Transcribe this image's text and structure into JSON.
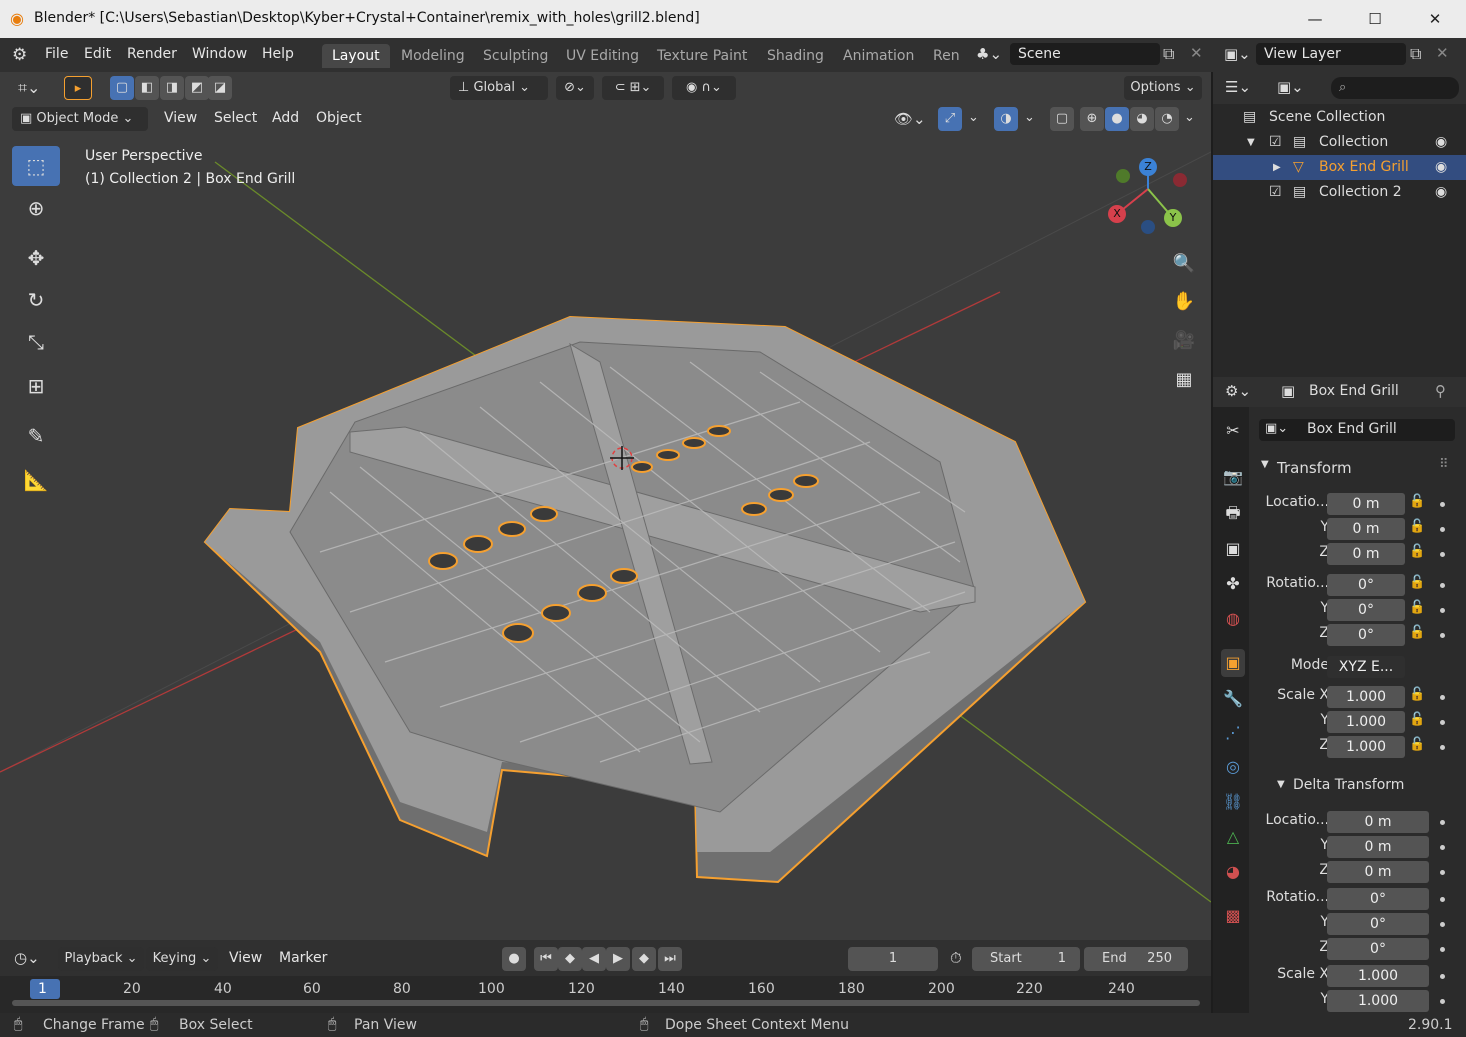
{
  "window": {
    "title": "Blender* [C:\\Users\\Sebastian\\Desktop\\Kyber+Crystal+Container\\remix_with_holes\\grill2.blend]",
    "min": "—",
    "max": "☐",
    "close": "✕"
  },
  "menu": [
    "File",
    "Edit",
    "Render",
    "Window",
    "Help"
  ],
  "workspaces": [
    "Layout",
    "Modeling",
    "Sculpting",
    "UV Editing",
    "Texture Paint",
    "Shading",
    "Animation",
    "Ren"
  ],
  "scene": {
    "name": "Scene",
    "view_layer": "View Layer"
  },
  "viewport": {
    "transform_orientation": "Global",
    "options": "Options",
    "mode": "Object Mode",
    "header_menus": [
      "View",
      "Select",
      "Add",
      "Object"
    ],
    "info_line1": "User Perspective",
    "info_line2": "(1) Collection 2 | Box End Grill",
    "gizmo": {
      "x": "X",
      "y": "Y",
      "z": "Z"
    }
  },
  "outliner": {
    "rows": [
      "Scene Collection",
      "Collection",
      "Box End Grill",
      "Collection 2"
    ]
  },
  "properties": {
    "object_name": "Box End Grill",
    "data_name": "Box End Grill",
    "transform_header": "Transform",
    "location_label": "Locatio...",
    "rotation_label": "Rotatio...",
    "mode_label": "Mode",
    "mode_value": "XYZ E...",
    "scale_label": "Scale X",
    "y": "Y",
    "z": "Z",
    "loc": [
      "0 m",
      "0 m",
      "0 m"
    ],
    "rot": [
      "0°",
      "0°",
      "0°"
    ],
    "scale": [
      "1.000",
      "1.000",
      "1.000"
    ],
    "delta_header": "Delta Transform",
    "dloc": [
      "0 m",
      "0 m",
      "0 m"
    ],
    "drot": [
      "0°",
      "0°",
      "0°"
    ],
    "dscale": [
      "1.000",
      "1.000"
    ]
  },
  "timeline": {
    "menus": [
      "Playback",
      "Keying",
      "View",
      "Marker"
    ],
    "current_frame": "1",
    "start_label": "Start",
    "start": "1",
    "end_label": "End",
    "end": "250",
    "ruler": [
      "1",
      "20",
      "40",
      "60",
      "80",
      "100",
      "120",
      "140",
      "160",
      "180",
      "200",
      "220",
      "240"
    ]
  },
  "status": {
    "change_frame": "Change Frame",
    "box_select": "Box Select",
    "pan_view": "Pan View",
    "context_menu": "Dope Sheet Context Menu",
    "version": "2.90.1"
  },
  "colors": {
    "accent": "#4772b3",
    "selection": "#f5a030",
    "mesh": "#9a9a9a"
  }
}
